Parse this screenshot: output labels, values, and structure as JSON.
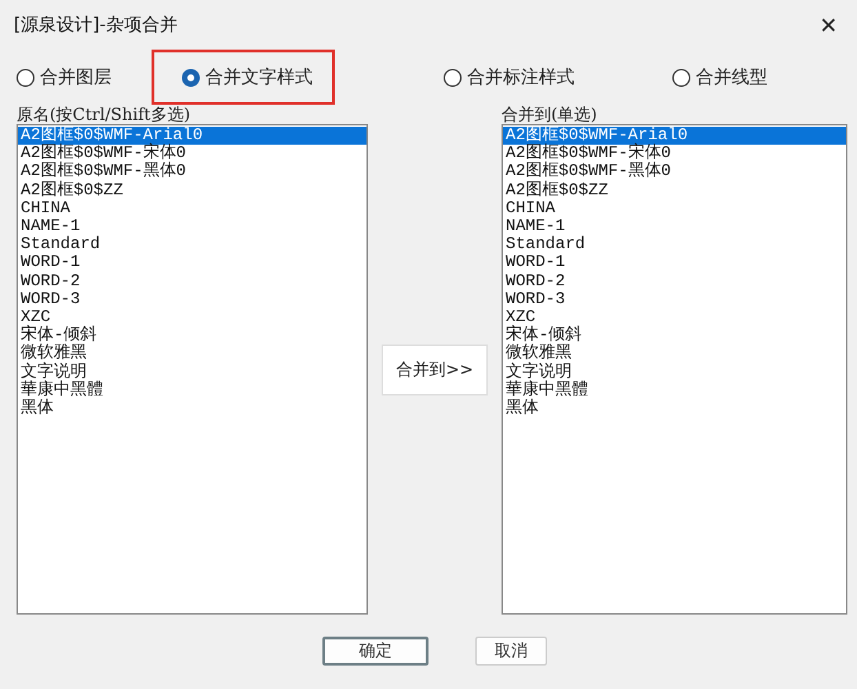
{
  "window": {
    "title": "[源泉设计]-杂项合并",
    "close": "✕"
  },
  "options": [
    {
      "label": "合并图层",
      "selected": false,
      "highlighted": false
    },
    {
      "label": "合并文字样式",
      "selected": true,
      "highlighted": true
    },
    {
      "label": "合并标注样式",
      "selected": false,
      "highlighted": false
    },
    {
      "label": "合并线型",
      "selected": false,
      "highlighted": false
    }
  ],
  "source_list": {
    "label": "原名(按Ctrl/Shift多选)",
    "items": [
      {
        "text": "A2图框$0$WMF-Arial0",
        "selected": true
      },
      {
        "text": "A2图框$0$WMF-宋体0",
        "selected": false
      },
      {
        "text": "A2图框$0$WMF-黑体0",
        "selected": false
      },
      {
        "text": "A2图框$0$ZZ",
        "selected": false
      },
      {
        "text": "CHINA",
        "selected": false
      },
      {
        "text": "NAME-1",
        "selected": false
      },
      {
        "text": "Standard",
        "selected": false
      },
      {
        "text": "WORD-1",
        "selected": false
      },
      {
        "text": "WORD-2",
        "selected": false
      },
      {
        "text": "WORD-3",
        "selected": false
      },
      {
        "text": "XZC",
        "selected": false
      },
      {
        "text": "宋体-倾斜",
        "selected": false
      },
      {
        "text": "微软雅黑",
        "selected": false
      },
      {
        "text": "文字说明",
        "selected": false
      },
      {
        "text": "華康中黑體",
        "selected": false
      },
      {
        "text": "黑体",
        "selected": false
      }
    ]
  },
  "merge_button": "合并到>>",
  "target_list": {
    "label": "合并到(单选)",
    "items": [
      {
        "text": "A2图框$0$WMF-Arial0",
        "selected": true
      },
      {
        "text": "A2图框$0$WMF-宋体0",
        "selected": false
      },
      {
        "text": "A2图框$0$WMF-黑体0",
        "selected": false
      },
      {
        "text": "A2图框$0$ZZ",
        "selected": false
      },
      {
        "text": "CHINA",
        "selected": false
      },
      {
        "text": "NAME-1",
        "selected": false
      },
      {
        "text": "Standard",
        "selected": false
      },
      {
        "text": "WORD-1",
        "selected": false
      },
      {
        "text": "WORD-2",
        "selected": false
      },
      {
        "text": "WORD-3",
        "selected": false
      },
      {
        "text": "XZC",
        "selected": false
      },
      {
        "text": "宋体-倾斜",
        "selected": false
      },
      {
        "text": "微软雅黑",
        "selected": false
      },
      {
        "text": "文字说明",
        "selected": false
      },
      {
        "text": "華康中黑體",
        "selected": false
      },
      {
        "text": "黑体",
        "selected": false
      }
    ]
  },
  "buttons": [
    {
      "label": "确定",
      "default": true
    },
    {
      "label": "取消",
      "default": false
    }
  ]
}
